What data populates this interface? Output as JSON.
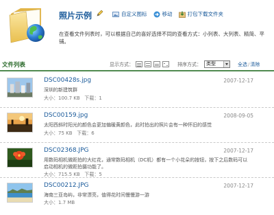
{
  "header": {
    "title": "照片示例",
    "actions": [
      {
        "label": "自定义图标",
        "icon": "image-icon"
      },
      {
        "label": "移动",
        "icon": "move-icon"
      },
      {
        "label": "打包下载文件夹",
        "icon": "package-download-icon"
      }
    ],
    "description": "在查看文件列表时，可以根据自己的喜好选择不同的查看方式：小列表、大列表、精简、平铺。"
  },
  "section": {
    "title": "文件列表",
    "view_label": "显示方式：",
    "sort_label": "排序方式：",
    "sort_value": "类型",
    "select_all": "全选",
    "separator": "/",
    "clear": "清除"
  },
  "files": [
    {
      "name": "DSC00428s.jpg",
      "date": "2007-12-17",
      "desc": "深圳的新建筑群",
      "size": "大小：100.7 KB",
      "downloads": "下载：1"
    },
    {
      "name": "DSC00159.jpg",
      "date": "2008-09-05",
      "desc": "太阳西斜时阳光的颜色会更加偏暖黄颜色，此时拍出的照片会有一种怀旧的感觉",
      "size": "大小：75 KB",
      "downloads": "下载：6"
    },
    {
      "name": "DSC02368.JPG",
      "date": "2007-12-17",
      "desc": "用数码相机微距拍的大红花，通常数码相机（DC机）都有一个小花朵的按钮，按下之后数码可以启动相机的微距拍摄功能了。",
      "size": "大小：715.5 KB",
      "downloads": "下载：5"
    },
    {
      "name": "DSC00212.JPG",
      "date": "2007-12-17",
      "desc": "海南三亚岛屿，非常漂亮，值得花时间慢慢游一游",
      "size": "大小：1.7 MB",
      "downloads": ""
    }
  ],
  "colors": {
    "link": "#1a5a9a",
    "section_title": "#2c6b2c",
    "rule": "#4f8a4f"
  }
}
